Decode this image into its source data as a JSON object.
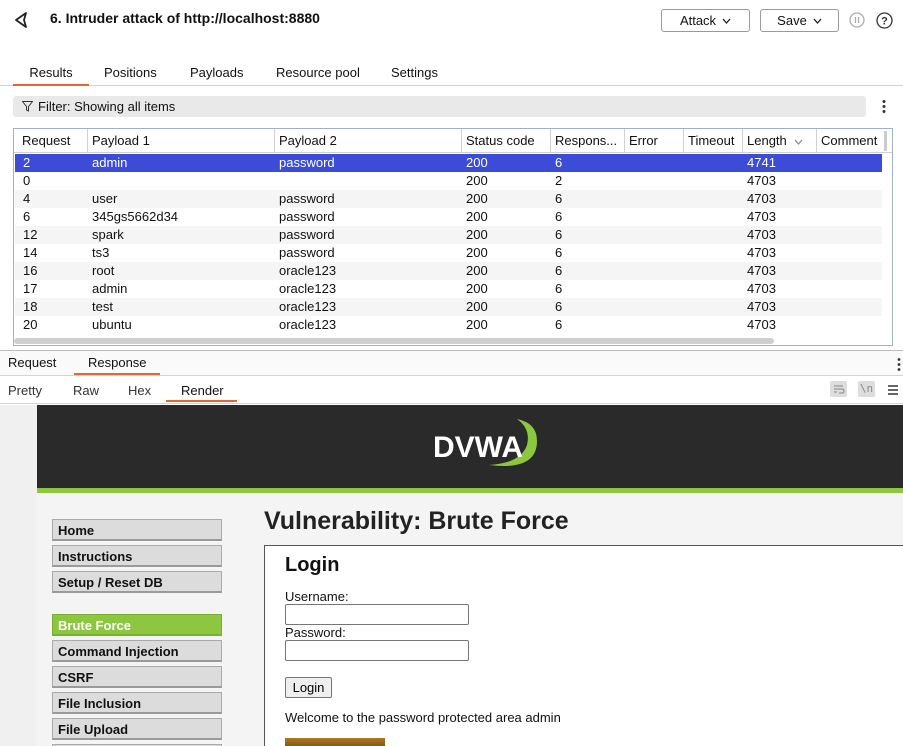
{
  "header": {
    "title": "6. Intruder attack of http://localhost:8880",
    "attack_label": "Attack",
    "save_label": "Save"
  },
  "tabs": [
    "Results",
    "Positions",
    "Payloads",
    "Resource pool",
    "Settings"
  ],
  "filter": {
    "text": "Filter: Showing all items"
  },
  "table": {
    "columns": [
      "Request",
      "Payload 1",
      "Payload 2",
      "Status code",
      "Respons...",
      "Error",
      "Timeout",
      "Length",
      "Comment"
    ],
    "rows": [
      {
        "request": "2",
        "p1": "admin",
        "p2": "password",
        "status": "200",
        "resp": "6",
        "length": "4741"
      },
      {
        "request": "0",
        "p1": "",
        "p2": "",
        "status": "200",
        "resp": "2",
        "length": "4703"
      },
      {
        "request": "4",
        "p1": "user",
        "p2": "password",
        "status": "200",
        "resp": "6",
        "length": "4703"
      },
      {
        "request": "6",
        "p1": "345gs5662d34",
        "p2": "password",
        "status": "200",
        "resp": "6",
        "length": "4703"
      },
      {
        "request": "12",
        "p1": "spark",
        "p2": "password",
        "status": "200",
        "resp": "6",
        "length": "4703"
      },
      {
        "request": "14",
        "p1": "ts3",
        "p2": "password",
        "status": "200",
        "resp": "6",
        "length": "4703"
      },
      {
        "request": "16",
        "p1": "root",
        "p2": "oracle123",
        "status": "200",
        "resp": "6",
        "length": "4703"
      },
      {
        "request": "17",
        "p1": "admin",
        "p2": "oracle123",
        "status": "200",
        "resp": "6",
        "length": "4703"
      },
      {
        "request": "18",
        "p1": "test",
        "p2": "oracle123",
        "status": "200",
        "resp": "6",
        "length": "4703"
      },
      {
        "request": "20",
        "p1": "ubuntu",
        "p2": "oracle123",
        "status": "200",
        "resp": "6",
        "length": "4703"
      }
    ]
  },
  "req_resp_tabs": [
    "Request",
    "Response"
  ],
  "view_tabs": [
    "Pretty",
    "Raw",
    "Hex",
    "Render"
  ],
  "view_icons": {
    "wrap": "wrap-icon",
    "newline": "\\n"
  },
  "dvwa": {
    "logo": "DVWA",
    "menu": [
      "Home",
      "Instructions",
      "Setup / Reset DB",
      "Brute Force",
      "Command Injection",
      "CSRF",
      "File Inclusion",
      "File Upload"
    ],
    "page_title": "Vulnerability: Brute Force",
    "login_heading": "Login",
    "username_label": "Username:",
    "password_label": "Password:",
    "login_button": "Login",
    "welcome": "Welcome to the password protected area admin"
  },
  "colors": {
    "accent": "#e8652f",
    "selected_row": "#3d4cd6",
    "dvwa_green": "#8dc63f"
  }
}
